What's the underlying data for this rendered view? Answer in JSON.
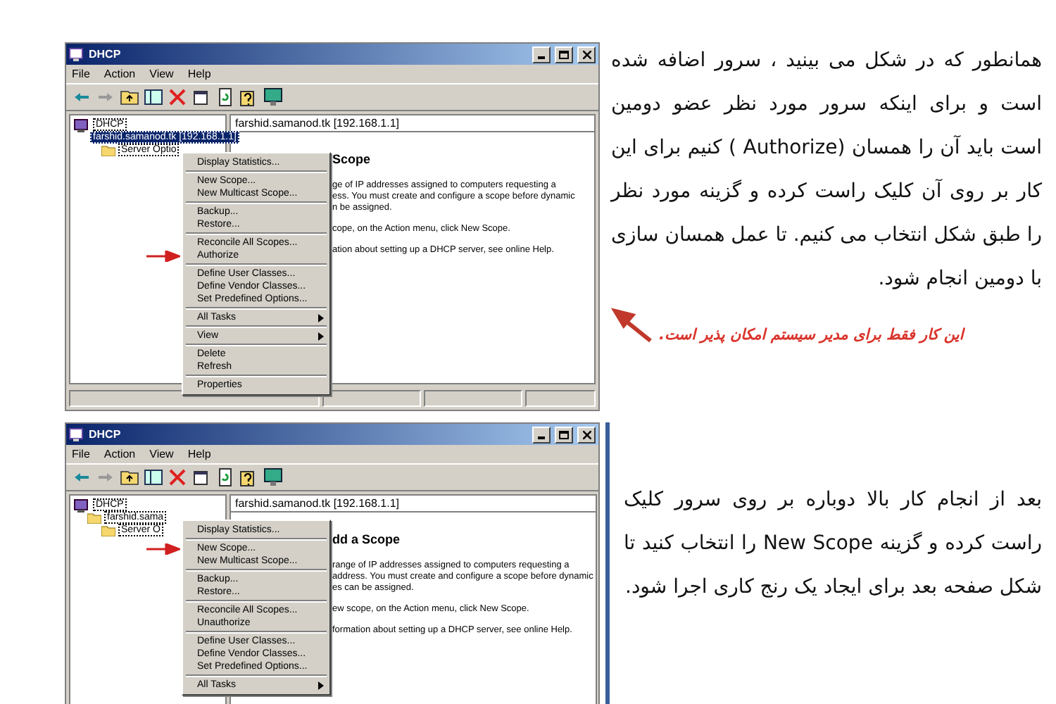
{
  "figures": [
    {
      "title": "DHCP",
      "menus": [
        "File",
        "Action",
        "View",
        "Help"
      ],
      "tree": {
        "label": "DHCP",
        "children": [
          {
            "label": "farshid.samanod.tk [192.168.1.1]",
            "selected": true,
            "children": [
              {
                "label": "Server Optio",
                "selected": false
              }
            ]
          }
        ]
      },
      "header": "farshid.samanod.tk [192.168.1.1]",
      "heading": "Scope",
      "lines": [
        [
          "ge of IP addresses assigned to computers requesting a",
          "ess. You must create and configure a scope before dynamic",
          "n be assigned."
        ],
        [
          "cope, on the Action menu, click New Scope."
        ],
        [
          "ation about setting up a DHCP server, see online Help."
        ]
      ],
      "context_menu": [
        [
          {
            "label": "Display Statistics...",
            "kind": "command",
            "pointed": false
          }
        ],
        [
          {
            "label": "New Scope...",
            "kind": "command",
            "pointed": false
          },
          {
            "label": "New Multicast Scope...",
            "kind": "command",
            "pointed": false
          }
        ],
        [
          {
            "label": "Backup...",
            "kind": "command",
            "pointed": false
          },
          {
            "label": "Restore...",
            "kind": "command",
            "pointed": false
          }
        ],
        [
          {
            "label": "Reconcile All Scopes...",
            "kind": "command",
            "pointed": false
          },
          {
            "label": "Authorize",
            "kind": "command",
            "pointed": true
          }
        ],
        [
          {
            "label": "Define User Classes...",
            "kind": "command",
            "pointed": false
          },
          {
            "label": "Define Vendor Classes...",
            "kind": "command",
            "pointed": false
          },
          {
            "label": "Set Predefined Options...",
            "kind": "command",
            "pointed": false
          }
        ],
        [
          {
            "label": "All Tasks",
            "kind": "submenu",
            "pointed": false
          }
        ],
        [
          {
            "label": "View",
            "kind": "submenu",
            "pointed": false
          }
        ],
        [
          {
            "label": "Delete",
            "kind": "command",
            "pointed": false
          },
          {
            "label": "Refresh",
            "kind": "command",
            "pointed": false
          }
        ],
        [
          {
            "label": "Properties",
            "kind": "command",
            "pointed": false
          }
        ]
      ]
    },
    {
      "title": "DHCP",
      "menus": [
        "File",
        "Action",
        "View",
        "Help"
      ],
      "tree": {
        "label": "DHCP",
        "children": [
          {
            "label": "farshid.sama",
            "selected": false,
            "children": [
              {
                "label": "Server O",
                "selected": false
              }
            ]
          }
        ]
      },
      "header": "farshid.samanod.tk [192.168.1.1]",
      "heading": "dd a Scope",
      "lines": [
        [
          "range of IP addresses assigned to computers requesting a",
          "address. You must create and configure a scope before dynamic",
          "es can be assigned."
        ],
        [
          "ew scope, on the Action menu, click New Scope."
        ],
        [
          "formation about setting up a DHCP server, see online Help."
        ]
      ],
      "context_menu": [
        [
          {
            "label": "Display Statistics...",
            "kind": "command",
            "pointed": false
          }
        ],
        [
          {
            "label": "New Scope...",
            "kind": "command",
            "pointed": true
          },
          {
            "label": "New Multicast Scope...",
            "kind": "command",
            "pointed": false
          }
        ],
        [
          {
            "label": "Backup...",
            "kind": "command",
            "pointed": false
          },
          {
            "label": "Restore...",
            "kind": "command",
            "pointed": false
          }
        ],
        [
          {
            "label": "Reconcile All Scopes...",
            "kind": "command",
            "pointed": false
          },
          {
            "label": "Unauthorize",
            "kind": "command",
            "pointed": false
          }
        ],
        [
          {
            "label": "Define User Classes...",
            "kind": "command",
            "pointed": false
          },
          {
            "label": "Define Vendor Classes...",
            "kind": "command",
            "pointed": false
          },
          {
            "label": "Set Predefined Options...",
            "kind": "command",
            "pointed": false
          }
        ],
        [
          {
            "label": "All Tasks",
            "kind": "submenu",
            "pointed": false
          }
        ]
      ]
    }
  ],
  "paragraphs": [
    "همانطور که در شکل می بینید ، سرور اضافه شده است و برای اینکه سرور مورد نظر عضو دومین است باید آن را همسان (Authorize ) کنیم برای این کار بر روی آن کلیک راست کرده  و گزینه مورد نظر را طبق شکل انتخاب می کنیم. تا عمل همسان سازی با دومین انجام شود.",
    "بعد از انجام کار بالا دوباره بر روی سرور کلیک راست کرده و گزینه New Scope را انتخاب کنید تا شکل صفحه بعد برای ایجاد یک رنج کاری اجرا شود."
  ],
  "note": "این کار فقط برای مدیر سیستم امکان پذیر است."
}
